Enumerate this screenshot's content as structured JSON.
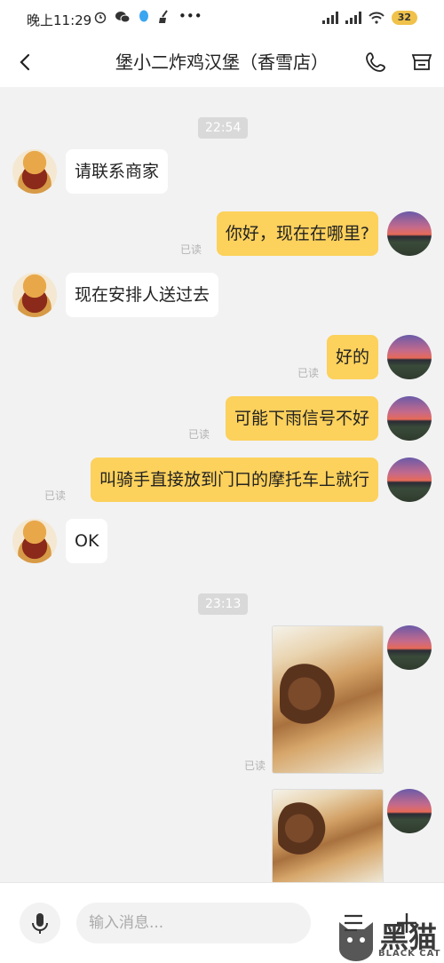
{
  "status_bar": {
    "time": "晚上11:29",
    "icons": [
      "alarm-icon",
      "wechat-icon",
      "qq-icon",
      "broom-icon",
      "more-dots-icon"
    ],
    "right_icons": [
      "signal-icon",
      "hd-signal-icon",
      "wifi-icon"
    ],
    "battery": "32"
  },
  "header": {
    "title": "堡小二炸鸡汉堡（香雪店）",
    "icons": [
      "back-icon",
      "phone-icon",
      "store-icon"
    ]
  },
  "chat": {
    "timestamps": [
      "22:54",
      "23:13"
    ],
    "read_label": "已读",
    "messages": [
      {
        "side": "in",
        "text": "请联系商家"
      },
      {
        "side": "out",
        "text": "你好，现在在哪里?",
        "read": "已读"
      },
      {
        "side": "in",
        "text": "现在安排人送过去"
      },
      {
        "side": "out",
        "text": "好的",
        "read": "已读"
      },
      {
        "side": "out",
        "text": "可能下雨信号不好",
        "read": "已读"
      },
      {
        "side": "out",
        "text": "叫骑手直接放到门口的摩托车上就行",
        "read": "已读"
      },
      {
        "side": "in",
        "text": "OK"
      },
      {
        "side": "out",
        "type": "image",
        "read": "已读"
      },
      {
        "side": "out",
        "type": "image"
      }
    ]
  },
  "input_bar": {
    "placeholder": "输入消息...",
    "icons": [
      "microphone-icon",
      "quick-reply-icon",
      "plus-icon"
    ]
  },
  "watermark": {
    "main": "黑猫",
    "sub": "BLACK CAT"
  }
}
